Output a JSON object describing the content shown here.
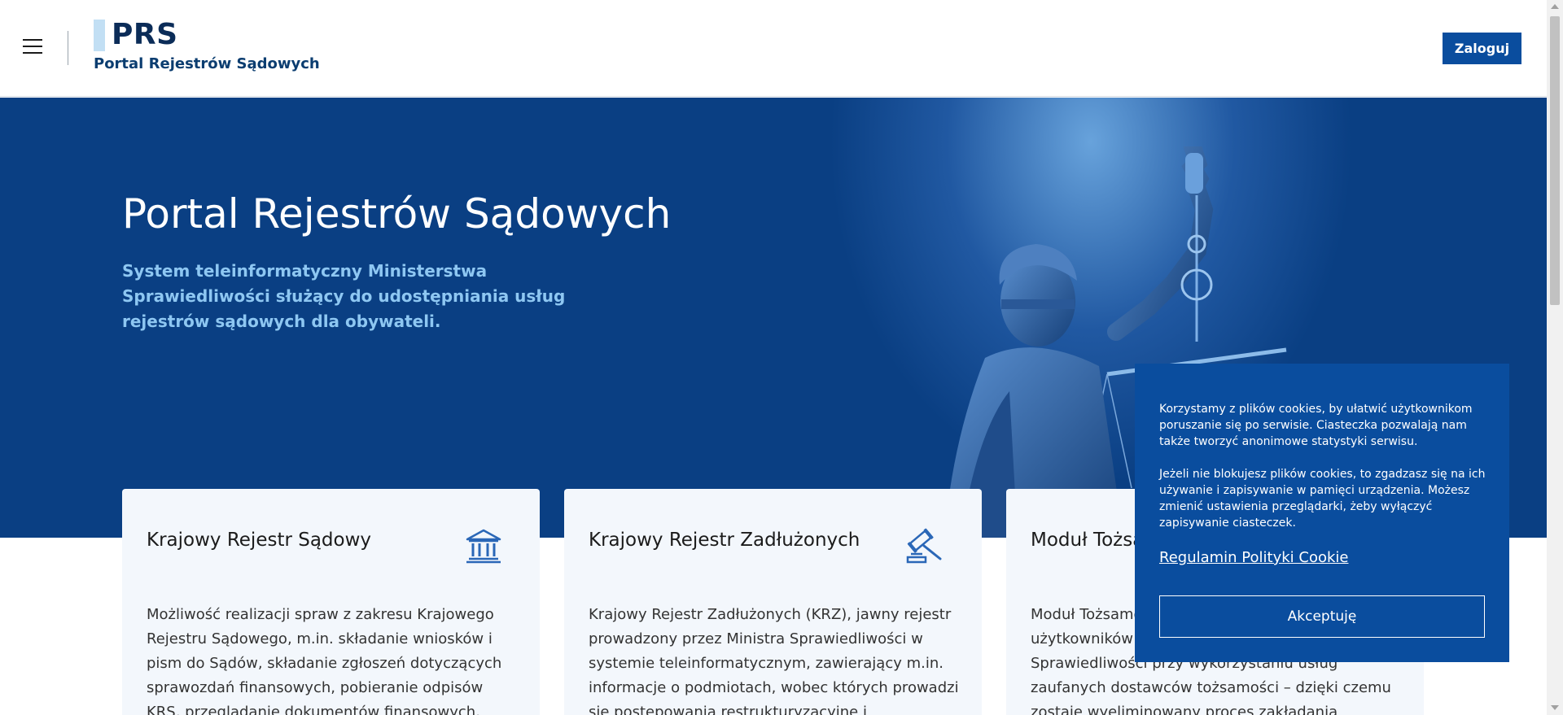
{
  "header": {
    "logo_short": "PRS",
    "logo_full": "Portal Rejestrów Sądowych",
    "login_label": "Zaloguj",
    "menu_icon": "hamburger-icon"
  },
  "hero": {
    "title": "Portal Rejestrów Sądowych",
    "description": "System teleinformatyczny Ministerstwa Sprawiedliwości służący do udostępniania usług rejestrów sądowych dla obywateli.",
    "image": "justice-statue-image"
  },
  "cards": [
    {
      "title": "Krajowy Rejestr Sądowy",
      "icon": "courthouse-icon",
      "text": "Możliwość realizacji spraw z zakresu Krajowego Rejestru Sądowego, m.in. składanie wniosków i pism do Sądów, składanie zgłoszeń dotyczących sprawozdań finansowych, pobieranie odpisów KRS, przeglądanie dokumentów finansowych, dostęp do"
    },
    {
      "title": "Krajowy Rejestr Zadłużonych",
      "icon": "gavel-icon",
      "text": "Krajowy Rejestr Zadłużonych (KRZ), jawny rejestr prowadzony przez Ministra Sprawiedliwości w systemie teleinformatycznym, zawierający m.in. informacje o podmiotach, wobec których prowadzi się postępowania restrukturyzacyjne i upadłościowe"
    },
    {
      "title": "Moduł Tożsamości",
      "icon": "identity-icon",
      "text": "Moduł Tożsamości umożliwia uwierzytelnienie użytkowników w systemach Ministerstwa Sprawiedliwości przy wykorzystaniu usług zaufanych dostawców tożsamości – dzięki czemu zostaje wyeliminowany proces zakładania użytkowników"
    }
  ],
  "cookie": {
    "paragraph1": "Korzystamy z plików cookies, by ułatwić użytkownikom poruszanie się po serwisie. Ciasteczka pozwalają nam także tworzyć anonimowe statystyki serwisu.",
    "paragraph2": "Jeżeli nie blokujesz plików cookies, to zgadzasz się na ich używanie i zapisywanie w pamięci urządzenia. Możesz zmienić ustawienia przeglądarki, żeby wyłączyć zapisywanie ciasteczek.",
    "link_label": "Regulamin Polityki Cookie",
    "accept_label": "Akceptuję"
  },
  "colors": {
    "brand_dark": "#0b2c58",
    "hero_bg": "#0a3f83",
    "accent_blue": "#0a4d9e",
    "hero_desc": "#8ec7f2",
    "card_bg": "#f3f7fc"
  }
}
